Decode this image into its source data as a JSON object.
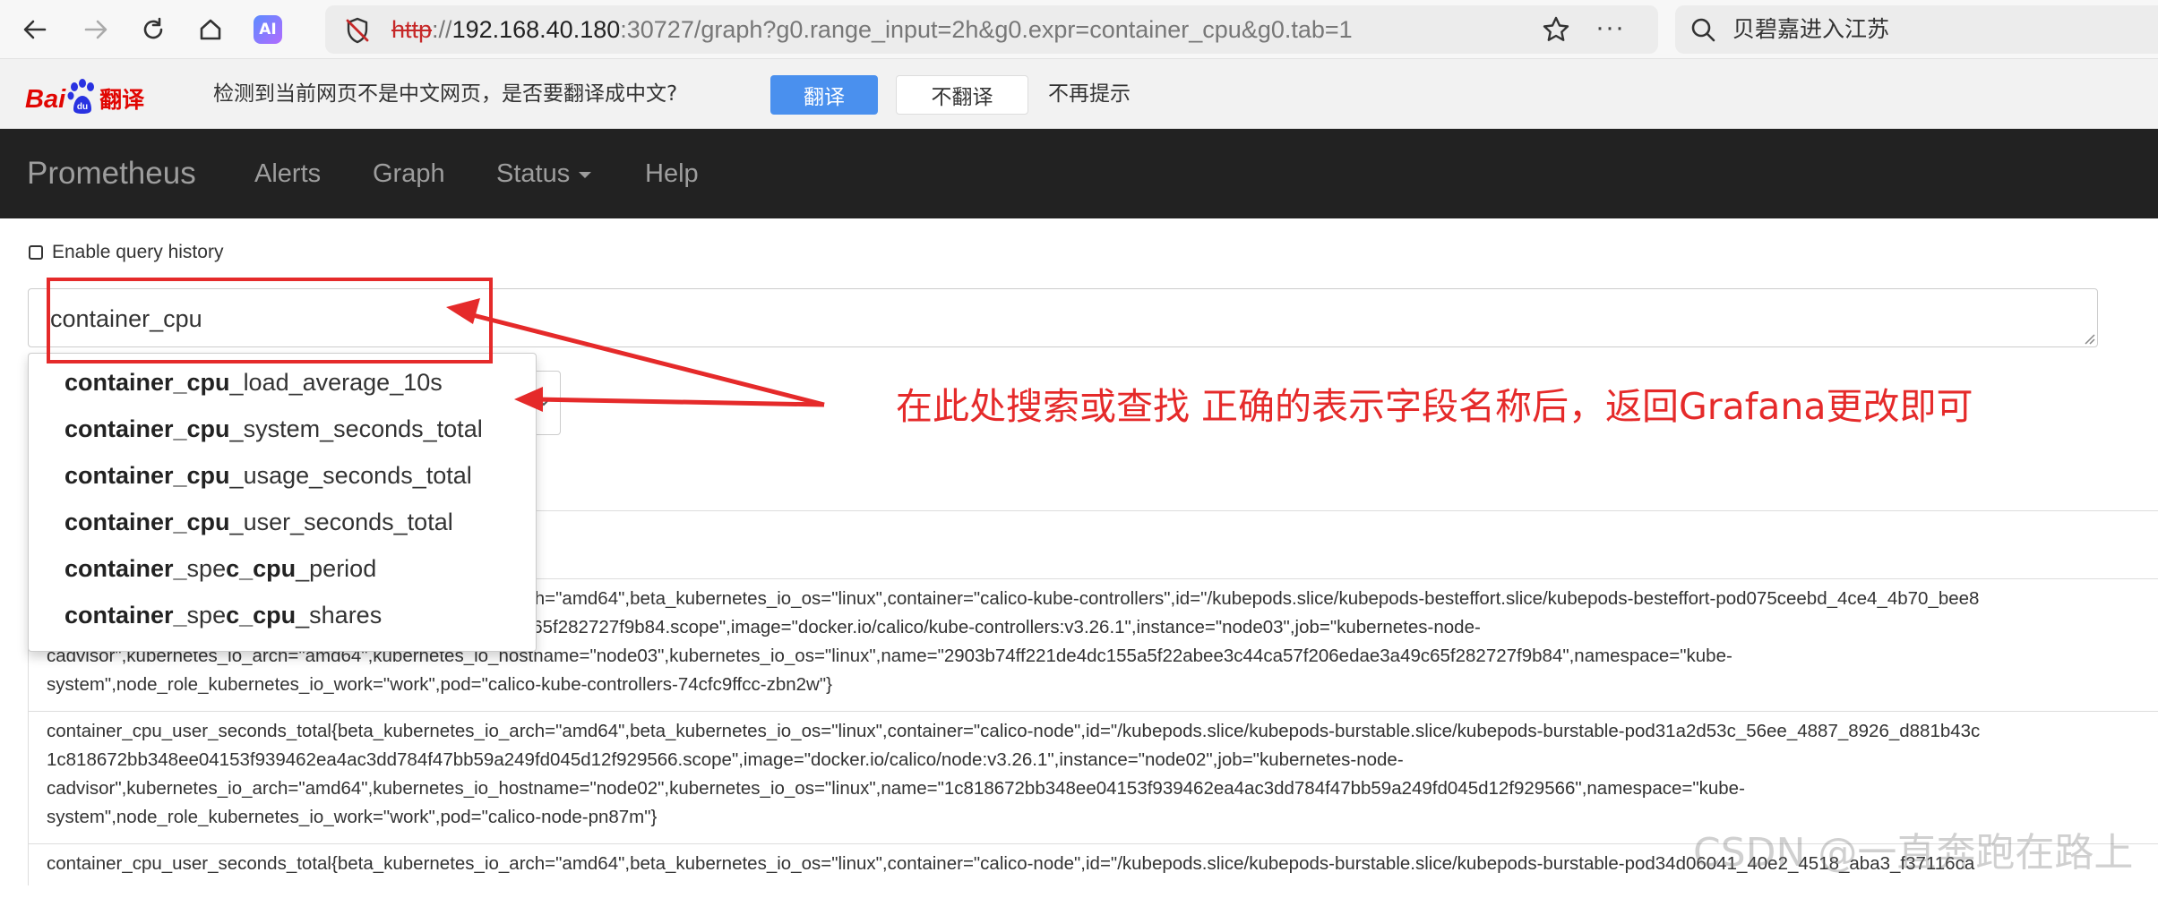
{
  "browser": {
    "url_protocol": "http",
    "url_separator": "://",
    "url_host": "192.168.40.180",
    "url_rest": ":30727/graph?g0.range_input=2h&g0.expr=container_cpu&g0.tab=1",
    "ai_label": "AI",
    "more_label": "···",
    "search_text": "贝碧嘉进入江苏"
  },
  "translate_bar": {
    "logo_bai": "Bai",
    "logo_du": "du",
    "logo_fanyi": "翻译",
    "message": "检测到当前网页不是中文网页，是否要翻译成中文?",
    "translate_button": "翻译",
    "no_translate_button": "不翻译",
    "dont_show_button": "不再提示",
    "accent_color": "#4a90ee"
  },
  "navbar": {
    "brand": "Prometheus",
    "links": [
      "Alerts",
      "Graph",
      "Status",
      "Help"
    ]
  },
  "query": {
    "history_label": "Enable query history",
    "expression": "container_cpu"
  },
  "autocomplete": {
    "items": [
      {
        "match": "container_cpu",
        "rest": "_load_average_10s"
      },
      {
        "match": "container_cpu",
        "rest": "_system_seconds_total"
      },
      {
        "match": "container_cpu",
        "rest": "_usage_seconds_total"
      },
      {
        "match": "container_cpu",
        "rest": "_user_seconds_total"
      },
      {
        "match": "container_",
        "mid": "spe",
        "match2": "c_cpu",
        "rest": "_period"
      },
      {
        "match": "container_",
        "mid": "spe",
        "match2": "c_cpu",
        "rest": "_shares"
      }
    ]
  },
  "results": {
    "rows": [
      {
        "lines": [
          "container_cpu_user_seconds_total{beta_kubernetes_io_arch=\"amd64\",beta_kubernetes_io_os=\"linux\",container=\"calico-kube-controllers\",id=\"/kubepods.slice/kubepods-besteffort.slice/kubepods-besteffort-pod075ceebd_4ce4_4b70_bee8",
          "2903b74ff221de4dc155a5f22abee3c44ca57f206edae3a49c65f282727f9b84.scope\",image=\"docker.io/calico/kube-controllers:v3.26.1\",instance=\"node03\",job=\"kubernetes-node-",
          "cadvisor\",kubernetes_io_arch=\"amd64\",kubernetes_io_hostname=\"node03\",kubernetes_io_os=\"linux\",name=\"2903b74ff221de4dc155a5f22abee3c44ca57f206edae3a49c65f282727f9b84\",namespace=\"kube-",
          "system\",node_role_kubernetes_io_work=\"work\",pod=\"calico-kube-controllers-74cfc9ffcc-zbn2w\"}"
        ]
      },
      {
        "lines": [
          "container_cpu_user_seconds_total{beta_kubernetes_io_arch=\"amd64\",beta_kubernetes_io_os=\"linux\",container=\"calico-node\",id=\"/kubepods.slice/kubepods-burstable.slice/kubepods-burstable-pod31a2d53c_56ee_4887_8926_d881b43c",
          "1c818672bb348ee04153f939462ea4ac3dd784f47bb59a249fd045d12f929566.scope\",image=\"docker.io/calico/node:v3.26.1\",instance=\"node02\",job=\"kubernetes-node-",
          "cadvisor\",kubernetes_io_arch=\"amd64\",kubernetes_io_hostname=\"node02\",kubernetes_io_os=\"linux\",name=\"1c818672bb348ee04153f939462ea4ac3dd784f47bb59a249fd045d12f929566\",namespace=\"kube-",
          "system\",node_role_kubernetes_io_work=\"work\",pod=\"calico-node-pn87m\"}"
        ]
      },
      {
        "lines": [
          "container_cpu_user_seconds_total{beta_kubernetes_io_arch=\"amd64\",beta_kubernetes_io_os=\"linux\",container=\"calico-node\",id=\"/kubepods.slice/kubepods-burstable.slice/kubepods-burstable-pod34d06041_40e2_4518_aba3_f37116ca"
        ]
      }
    ]
  },
  "annotation": {
    "text": "在此处搜索或查找 正确的表示字段名称后，返回Grafana更改即可",
    "color": "#e52a2a"
  },
  "watermark": "CSDN @一直奔跑在路上"
}
